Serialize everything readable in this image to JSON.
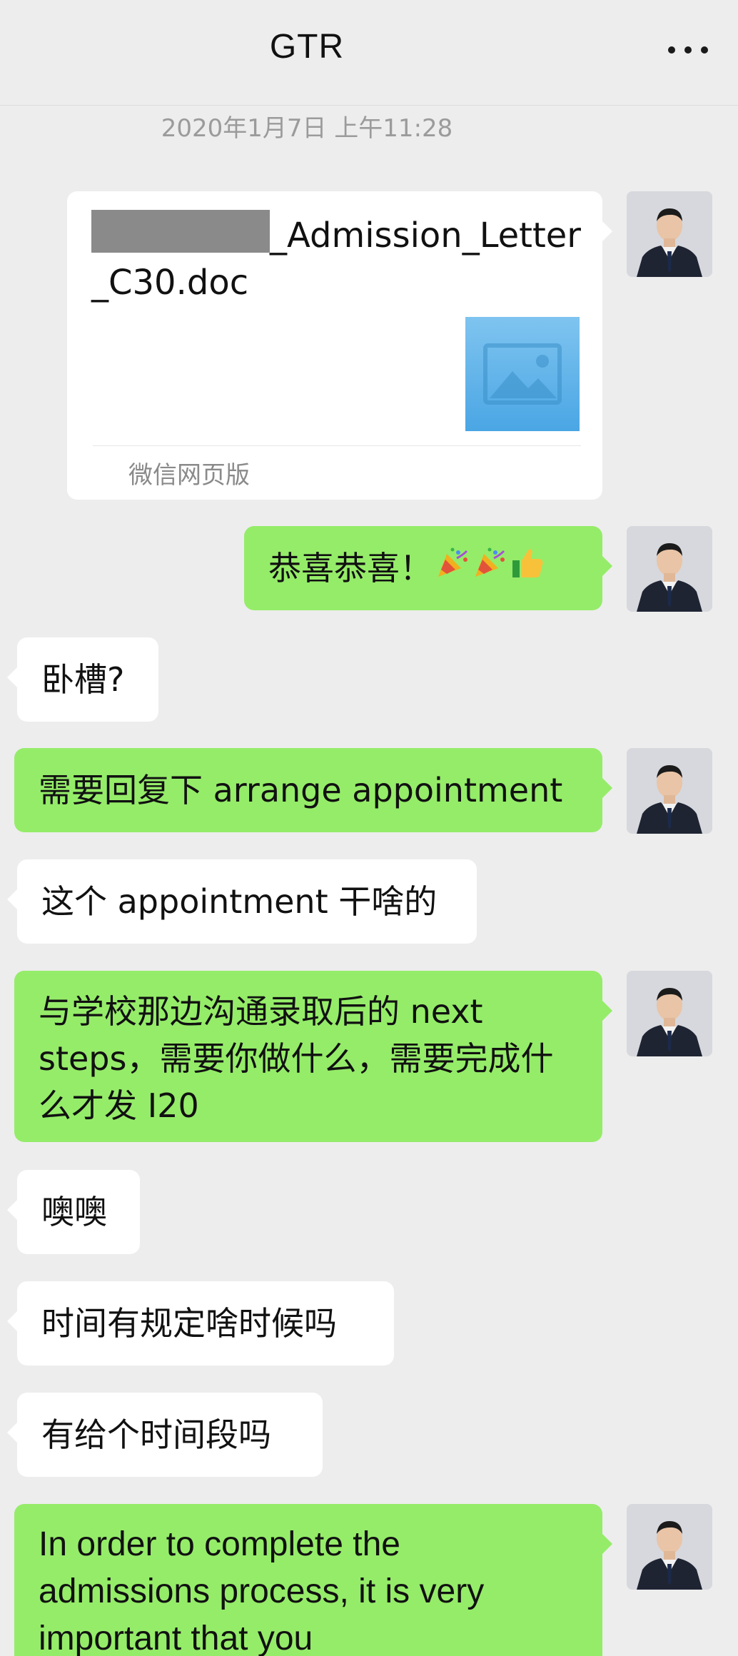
{
  "header": {
    "title": "GTR"
  },
  "timestamp": "2020年1月7日 上午11:28",
  "file_card": {
    "title_suffix": "_Admission_Letter_C30.doc",
    "source": "微信网页版"
  },
  "messages": [
    {
      "side": "out",
      "text": "恭喜恭喜！"
    },
    {
      "side": "in",
      "text": "卧槽?"
    },
    {
      "side": "out",
      "text": "需要回复下 arrange appointment"
    },
    {
      "side": "in",
      "text": "这个 appointment 干啥的"
    },
    {
      "side": "out",
      "text": "与学校那边沟通录取后的 next steps，需要你做什么，需要完成什么才发 I20"
    },
    {
      "side": "in",
      "text": "噢噢"
    },
    {
      "side": "in",
      "text": "时间有规定啥时候吗"
    },
    {
      "side": "in",
      "text": "有给个时间段吗"
    },
    {
      "side": "out",
      "text": "In order to complete the admissions process, it is very important that you"
    }
  ],
  "icons": {
    "more": "more-dots-icon",
    "party": "party-popper-icon",
    "thumbs": "thumbs-up-icon",
    "image": "image-placeholder-icon"
  },
  "colors": {
    "background": "#ededed",
    "outgoing_bubble": "#95ec69",
    "incoming_bubble": "#ffffff"
  }
}
